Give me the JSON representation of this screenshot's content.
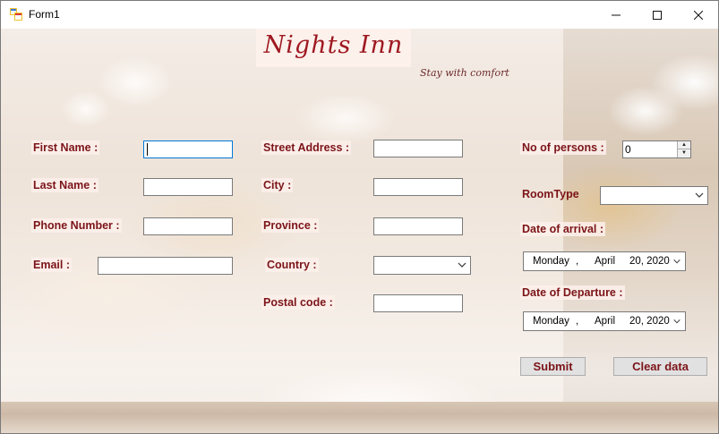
{
  "window": {
    "title": "Form1",
    "minimize": "–",
    "maximize": "☐",
    "close": "✕"
  },
  "header": {
    "logo": "Nights Inn",
    "tagline": "Stay with comfort"
  },
  "left": {
    "first_name_label": "First Name :",
    "last_name_label": "Last Name :",
    "phone_label": "Phone Number :",
    "email_label": "Email :",
    "first_name_value": "",
    "last_name_value": "",
    "phone_value": "",
    "email_value": ""
  },
  "middle": {
    "street_label": "Street Address :",
    "city_label": "City :",
    "province_label": "Province :",
    "country_label": "Country :",
    "postal_label": "Postal code :",
    "street_value": "",
    "city_value": "",
    "province_value": "",
    "country_value": "",
    "postal_value": ""
  },
  "right": {
    "persons_label": "No of persons  :",
    "persons_value": "0",
    "roomtype_label": "RoomType",
    "roomtype_value": "",
    "arrival_label": "Date of arrival  :",
    "arrival": {
      "weekday": "Monday",
      "sep": ",",
      "month": "April",
      "daydate": "20, 2020"
    },
    "departure_label": "Date of Departure  :",
    "departure": {
      "weekday": "Monday",
      "sep": ",",
      "month": "April",
      "daydate": "20, 2020"
    }
  },
  "buttons": {
    "submit": "Submit",
    "clear": "Clear data"
  },
  "icons": {
    "dropdown": "chevron-down-icon",
    "spin_up": "▲",
    "spin_down": "▼",
    "chevron": "⌵"
  },
  "colors": {
    "label_text": "#7c1418",
    "logo_text": "#9e1820",
    "focus_border": "#0078d7"
  }
}
